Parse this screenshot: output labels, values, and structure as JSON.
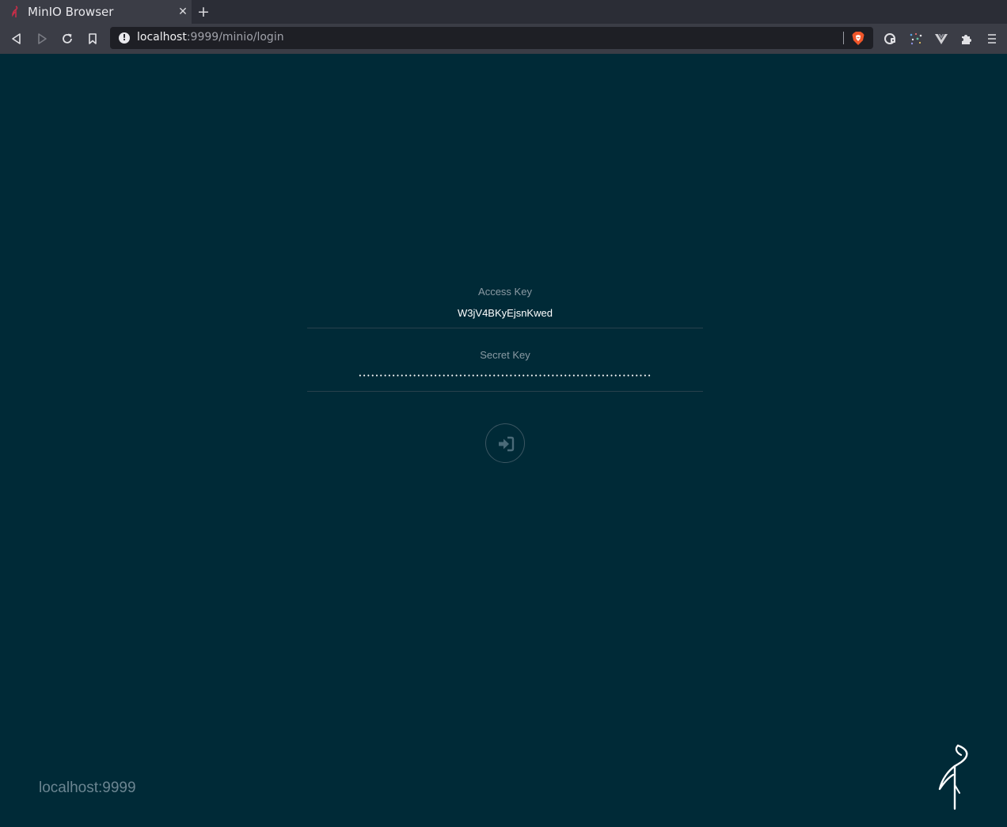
{
  "browser": {
    "tab": {
      "title": "MinIO Browser",
      "close_glyph": "✕"
    },
    "new_tab_glyph": "+",
    "url": {
      "host": "localhost",
      "rest": ":9999/minio/login"
    },
    "icons": {
      "back": "back-arrow-icon",
      "forward": "forward-arrow-icon",
      "reload": "reload-icon",
      "bookmark": "bookmark-icon",
      "site_info": "info-icon",
      "shield": "brave-shield-icon",
      "ext1": "password-manager-icon",
      "ext2": "dots-extension-icon",
      "ext3": "vue-devtools-icon",
      "extensions": "puzzle-icon",
      "menu": "hamburger-menu-icon"
    }
  },
  "login": {
    "access_key_label": "Access Key",
    "access_key_value": "W3jV4BKyEjsnKwed",
    "secret_key_label": "Secret Key",
    "secret_key_masked": "••••••••••••••••••••••••••••••••••••••••••••••••••••••••••••••••••••••",
    "submit_icon": "sign-in-icon"
  },
  "footer": {
    "host": "localhost:9999",
    "logo": "minio-bird-logo"
  },
  "colors": {
    "page_background": "#002a37",
    "chrome_background": "#3b3d46",
    "brand_red": "#c72e49"
  }
}
